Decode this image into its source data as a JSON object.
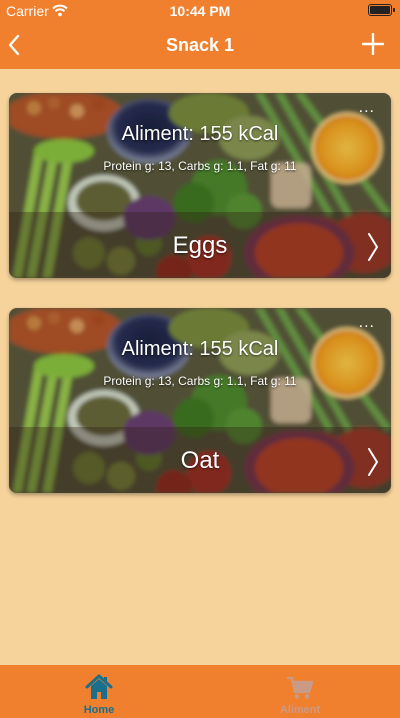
{
  "status_bar": {
    "carrier": "Carrier",
    "time": "10:44 PM"
  },
  "nav": {
    "title": "Snack 1",
    "back_icon": "chevron-left-icon",
    "add_icon": "plus-icon"
  },
  "cards": [
    {
      "kcal": "Aliment: 155 kCal",
      "macros": "Protein g: 13, Carbs g: 1.1, Fat g: 11",
      "name": "Eggs",
      "more": "..."
    },
    {
      "kcal": "Aliment: 155 kCal",
      "macros": "Protein g: 13, Carbs g: 1.1, Fat g: 11",
      "name": "Oat",
      "more": "..."
    }
  ],
  "tabs": [
    {
      "label": "Home",
      "icon": "home-icon",
      "active": true
    },
    {
      "label": "Aliment",
      "icon": "cart-icon",
      "active": false
    }
  ],
  "colors": {
    "bar": "#f07f2e",
    "background": "#f7d39c",
    "active_tab": "#1a6f8c",
    "inactive_tab": "#c99b86"
  }
}
